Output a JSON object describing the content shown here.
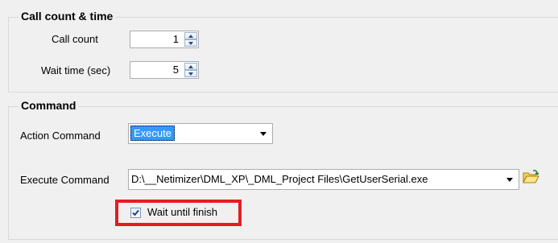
{
  "call_group": {
    "title": "Call count & time",
    "call_count_label": "Call count",
    "call_count_value": "1",
    "wait_time_label": "Wait time (sec)",
    "wait_time_value": "5"
  },
  "command_group": {
    "title": "Command",
    "action_label": "Action Command",
    "action_value": "Execute",
    "execute_label": "Execute Command",
    "execute_value": "D:\\__Netimizer\\DML_XP\\_DML_Project Files\\GetUserSerial.exe",
    "wait_label": "Wait until finish",
    "wait_checked": true
  },
  "colors": {
    "highlight": "#e31d24",
    "selection": "#3399ff"
  },
  "icons": {
    "open_folder": "folder-open-icon"
  }
}
